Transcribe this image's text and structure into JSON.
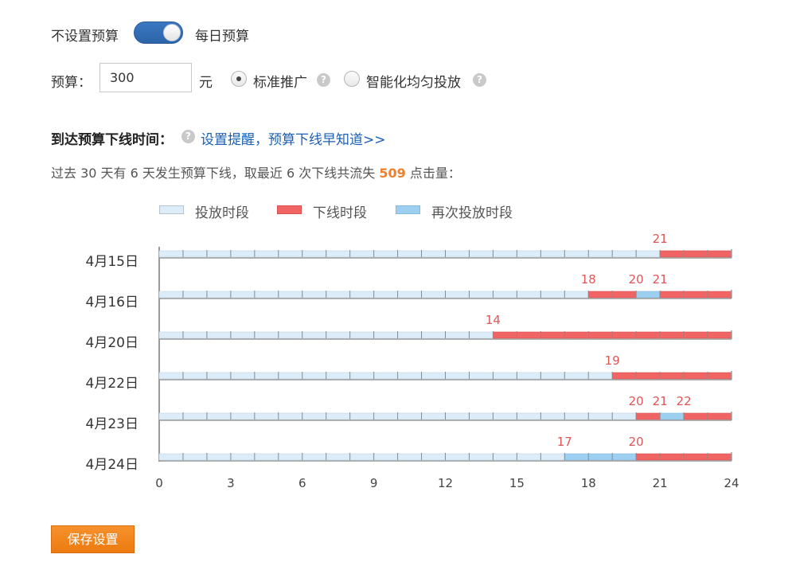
{
  "budget_mode": {
    "off_label": "不设置预算",
    "on_label": "每日预算",
    "enabled": true
  },
  "budget": {
    "label": "预算：",
    "value": "300",
    "unit": "元",
    "options": [
      {
        "label": "标准推广",
        "selected": true
      },
      {
        "label": "智能化均匀投放",
        "selected": false
      }
    ],
    "help_icon": "question-icon"
  },
  "offline": {
    "title": "到达预算下线时间：",
    "reminder_link": "设置提醒，预算下线早知道>>",
    "summary_parts": [
      "过去 30 天有 6 天发生预算下线，取最近 6 次下线共流失 ",
      "509",
      " 点击量："
    ]
  },
  "legend": [
    {
      "label": "投放时段",
      "color": "#dcecf8"
    },
    {
      "label": "下线时段",
      "color": "#f06464"
    },
    {
      "label": "再次投放时段",
      "color": "#9ccff0"
    }
  ],
  "chart_data": {
    "type": "bar",
    "x_ticks": [
      0,
      3,
      6,
      9,
      12,
      15,
      18,
      21,
      24
    ],
    "xlim": [
      0,
      24
    ],
    "rows": [
      {
        "date": "4月15日",
        "segments": [
          [
            0,
            21,
            "on"
          ],
          [
            21,
            24,
            "off"
          ]
        ],
        "labels": [
          21
        ]
      },
      {
        "date": "4月16日",
        "segments": [
          [
            0,
            18,
            "on"
          ],
          [
            18,
            20,
            "off"
          ],
          [
            20,
            21,
            "again"
          ],
          [
            21,
            24,
            "off"
          ]
        ],
        "labels": [
          18,
          20,
          21
        ]
      },
      {
        "date": "4月20日",
        "segments": [
          [
            0,
            14,
            "on"
          ],
          [
            14,
            24,
            "off"
          ]
        ],
        "labels": [
          14
        ]
      },
      {
        "date": "4月22日",
        "segments": [
          [
            0,
            19,
            "on"
          ],
          [
            19,
            24,
            "off"
          ]
        ],
        "labels": [
          19
        ]
      },
      {
        "date": "4月23日",
        "segments": [
          [
            0,
            20,
            "on"
          ],
          [
            20,
            21,
            "off"
          ],
          [
            21,
            22,
            "again"
          ],
          [
            22,
            24,
            "off"
          ]
        ],
        "labels": [
          20,
          21,
          22
        ]
      },
      {
        "date": "4月24日",
        "segments": [
          [
            0,
            17,
            "on"
          ],
          [
            17,
            20,
            "again"
          ],
          [
            20,
            24,
            "off"
          ]
        ],
        "labels": [
          17,
          20
        ]
      }
    ]
  },
  "save_button": "保存设置"
}
